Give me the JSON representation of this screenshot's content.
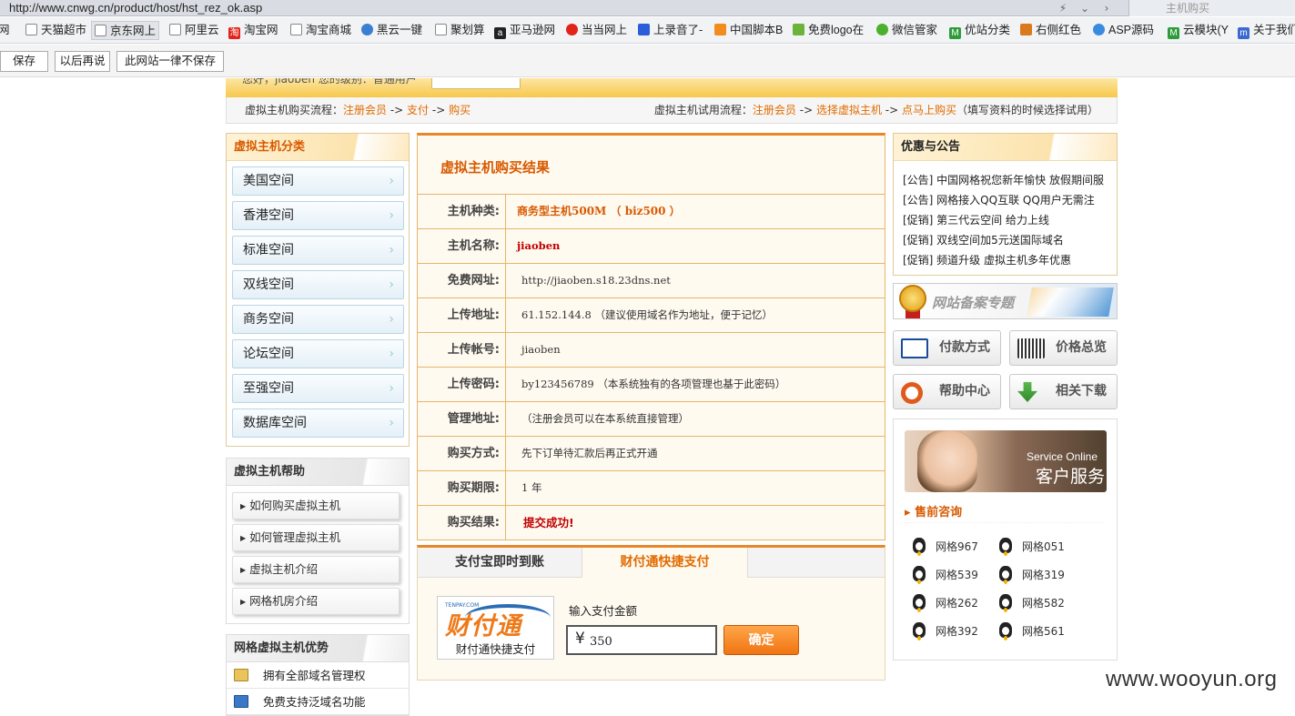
{
  "browser": {
    "url": "http://www.cnwg.cn/product/host/hst_rez_ok.asp",
    "tab_title": "主机购买",
    "bookmarks": [
      {
        "label": "网",
        "icon": "folder-icon"
      },
      {
        "label": "天猫超市",
        "icon": "page-icon"
      },
      {
        "label": "京东网上",
        "icon": "page-icon"
      },
      {
        "label": "阿里云",
        "icon": "page-icon"
      },
      {
        "label": "淘宝网",
        "icon": "taobao-icon"
      },
      {
        "label": "淘宝商城",
        "icon": "page-icon"
      },
      {
        "label": "黑云一键",
        "icon": "circle-icon"
      },
      {
        "label": "聚划算",
        "icon": "page-icon"
      },
      {
        "label": "亚马逊网",
        "icon": "amazon-icon"
      },
      {
        "label": "当当网上",
        "icon": "dangdang-icon"
      },
      {
        "label": "上录音了-",
        "icon": "paw-icon"
      },
      {
        "label": "中国脚本B",
        "icon": "cart-icon"
      },
      {
        "label": "免费logo在",
        "icon": "leaf-icon"
      },
      {
        "label": "微信管家",
        "icon": "wechat-icon"
      },
      {
        "label": "优站分类",
        "icon": "m-icon"
      },
      {
        "label": "右侧红色",
        "icon": "brush-icon"
      },
      {
        "label": "ASP源码",
        "icon": "moon-icon"
      },
      {
        "label": "云模块(Y",
        "icon": "m-icon"
      },
      {
        "label": "关于我们",
        "icon": "m-icon"
      }
    ],
    "password_bar": {
      "save": "保存",
      "later": "以后再说",
      "never": "此网站一律不保存"
    }
  },
  "topbar": {
    "text": "您好，jiaoben 您的级别：普通用户"
  },
  "flow": {
    "buy_label": "虚拟主机购买流程：",
    "buy_steps": [
      "注册会员",
      "支付",
      "购买"
    ],
    "trial_label": "虚拟主机试用流程：",
    "trial_steps": [
      "注册会员",
      "选择虚拟主机",
      "点马上购买"
    ],
    "trial_note": "（填写资料的时候选择试用）",
    "sep": " -> "
  },
  "sidebar": {
    "categories_title": "虚拟主机分类",
    "categories": [
      "美国空间",
      "香港空间",
      "标准空间",
      "双线空间",
      "商务空间",
      "论坛空间",
      "至强空间",
      "数据库空间"
    ],
    "help_title": "虚拟主机帮助",
    "help": [
      "如何购买虚拟主机",
      "如何管理虚拟主机",
      "虚拟主机介绍",
      "网格机房介绍"
    ],
    "adv_title": "网格虚拟主机优势",
    "adv": [
      "拥有全部域名管理权",
      "免费支持泛域名功能"
    ]
  },
  "result": {
    "title": "虚拟主机购买结果",
    "rows": [
      {
        "label": "主机种类:",
        "value": "商务型主机500M （ biz500 ）"
      },
      {
        "label": "主机名称:",
        "value": "jiaoben"
      },
      {
        "label": "免费网址:",
        "value": "http://jiaoben.s18.23dns.net"
      },
      {
        "label": "上传地址:",
        "value": "61.152.144.8 （建议使用域名作为地址，便于记忆）"
      },
      {
        "label": "上传帐号:",
        "value": "jiaoben"
      },
      {
        "label": "上传密码:",
        "value": "by123456789 （本系统独有的各项管理也基于此密码）"
      },
      {
        "label": "管理地址:",
        "value": "（注册会员可以在本系统直接管理）"
      },
      {
        "label": "购买方式:",
        "value": "先下订单待汇款后再正式开通"
      },
      {
        "label": "购买期限:",
        "value": "1 年"
      },
      {
        "label": "购买结果:",
        "value": "提交成功!"
      }
    ]
  },
  "payment": {
    "tabs": [
      "支付宝即时到账",
      "财付通快捷支付"
    ],
    "active_tab": 1,
    "logo_small": "TENPAY.COM",
    "logo_text": "财付通",
    "logo_caption": "财付通快捷支付",
    "amount_label": "输入支付金额",
    "currency": "¥",
    "amount": "350",
    "confirm": "确定"
  },
  "notice": {
    "title": "优惠与公告",
    "items": [
      "[公告] 中国网格祝您新年愉快 放假期间服",
      "[公告] 网格接入QQ互联 QQ用户无需注",
      "[促销] 第三代云空间 给力上线",
      "[促销] 双线空间加5元送国际域名",
      "[促销] 频道升级 虚拟主机多年优惠"
    ]
  },
  "beian": "网站备案专题",
  "quick": {
    "payment": "付款方式",
    "prices": "价格总览",
    "help": "帮助中心",
    "download": "相关下载"
  },
  "service": {
    "en": "Service Online",
    "cn": "客户服务",
    "presale": "售前咨询",
    "qq": [
      "网格967",
      "网格051",
      "网格539",
      "网格319",
      "网格262",
      "网格582",
      "网格392",
      "网格561"
    ]
  },
  "watermark": "www.wooyun.org",
  "colors": {
    "accent": "#d85a00",
    "border": "#e6b56a",
    "tab_active": "#e8862a",
    "success": "#c00000"
  }
}
